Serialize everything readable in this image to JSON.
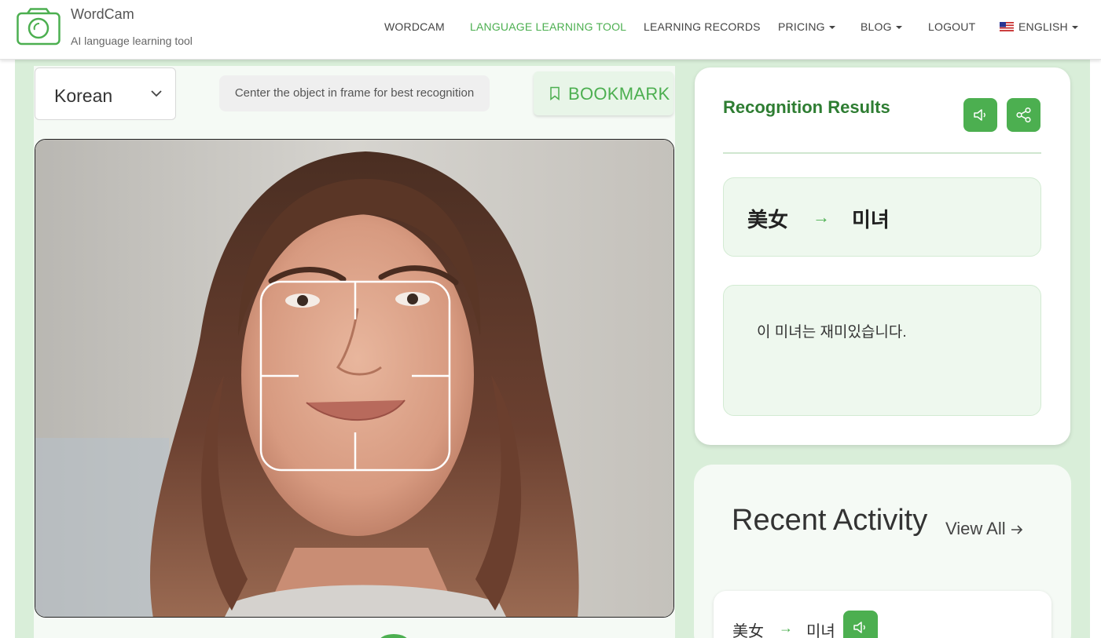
{
  "header": {
    "brand_name": "WordCam",
    "brand_tagline": "AI language learning tool",
    "nav": [
      {
        "label": "WORDCAM",
        "active": false,
        "dropdown": false
      },
      {
        "label": "LANGUAGE LEARNING TOOL",
        "active": true,
        "dropdown": false
      },
      {
        "label": "LEARNING RECORDS",
        "active": false,
        "dropdown": false
      },
      {
        "label": "PRICING",
        "active": false,
        "dropdown": true
      },
      {
        "label": "BLOG",
        "active": false,
        "dropdown": true
      },
      {
        "label": "LOGOUT",
        "active": false,
        "dropdown": false
      },
      {
        "label": "ENGLISH",
        "active": false,
        "dropdown": true,
        "icon": "us-flag-icon"
      }
    ]
  },
  "camera_panel": {
    "language_select": {
      "value": "Korean",
      "icon": "chevron-down-icon"
    },
    "hint": "Center the object in frame for best recognition",
    "bookmark": {
      "label": "BOOKMARK",
      "icon": "bookmark-icon"
    }
  },
  "results": {
    "title": "Recognition Results",
    "speak_icon": "speaker-icon",
    "share_icon": "share-icon",
    "source_word": "美女",
    "arrow": "→",
    "target_word": "미녀",
    "sentence": "이 미녀는 재미있습니다."
  },
  "activity": {
    "title": "Recent Activity",
    "view_all": "View All",
    "items": [
      {
        "source": "美女",
        "arrow": "→",
        "target": "미녀"
      }
    ]
  },
  "colors": {
    "accent": "#4caf50",
    "accent_dark": "#2e7d32",
    "panel_bg": "#d9eed9",
    "card_tint": "#eef8ee"
  }
}
